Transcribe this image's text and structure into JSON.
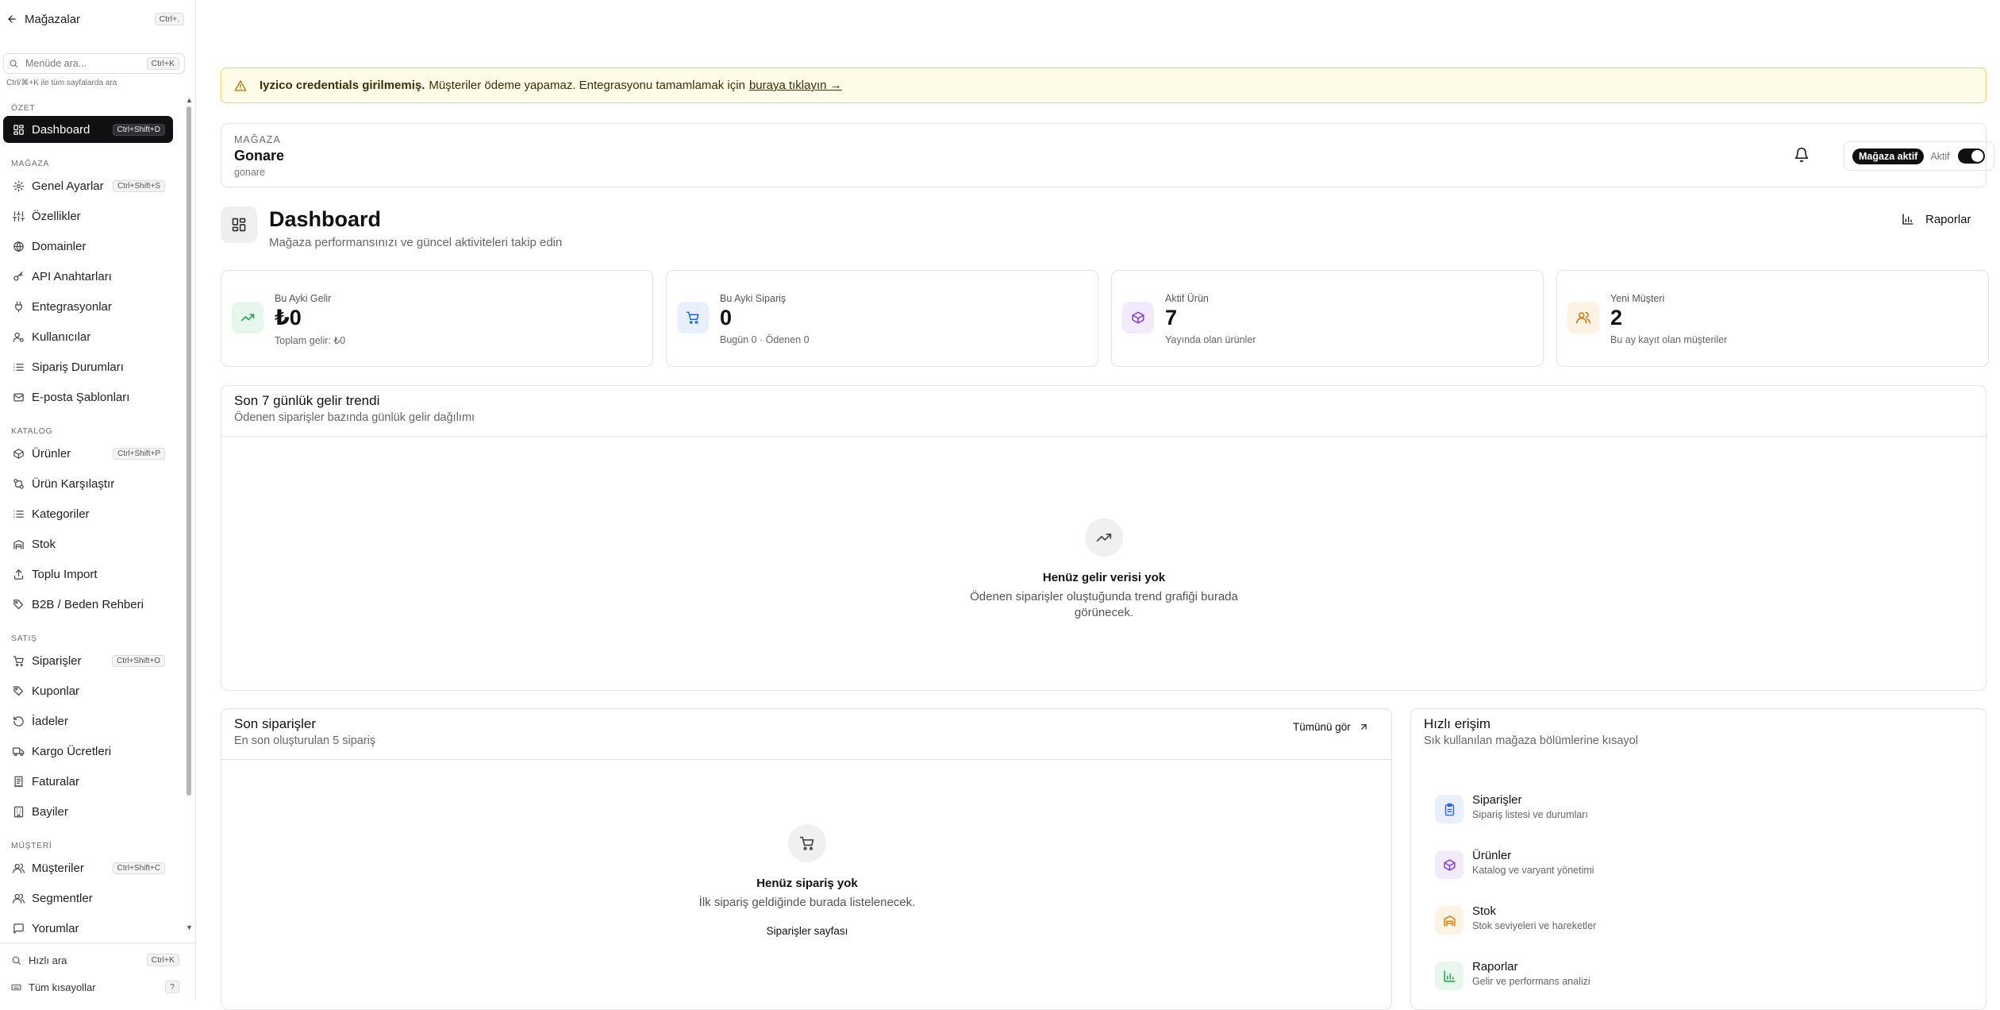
{
  "sidebar": {
    "back_label": "Mağazalar",
    "back_shortcut": "Ctrl+.",
    "search_placeholder": "Menüde ara...",
    "search_shortcut": "Ctrl+K",
    "search_hint": "Ctrl/⌘+K ile tüm sayfalarda ara",
    "sections": {
      "ozet": "ÖZET",
      "magaza": "MAĞAZA",
      "katalog": "KATALOG",
      "satis": "SATIŞ",
      "musteri": "MÜŞTERİ"
    },
    "items": {
      "dashboard": {
        "label": "Dashboard",
        "shortcut": "Ctrl+Shift+D"
      },
      "genel": {
        "label": "Genel Ayarlar",
        "shortcut": "Ctrl+Shift+S"
      },
      "ozellikler": {
        "label": "Özellikler"
      },
      "domainler": {
        "label": "Domainler"
      },
      "api": {
        "label": "API Anahtarları"
      },
      "entegrasyonlar": {
        "label": "Entegrasyonlar"
      },
      "kullanicilar": {
        "label": "Kullanıcılar"
      },
      "siparis_durumlari": {
        "label": "Sipariş Durumları"
      },
      "eposta": {
        "label": "E-posta Şablonları"
      },
      "urunler": {
        "label": "Ürünler",
        "shortcut": "Ctrl+Shift+P"
      },
      "karsilastir": {
        "label": "Ürün Karşılaştır"
      },
      "kategoriler": {
        "label": "Kategoriler"
      },
      "stok": {
        "label": "Stok"
      },
      "import": {
        "label": "Toplu Import"
      },
      "b2b": {
        "label": "B2B / Beden Rehberi"
      },
      "siparisler": {
        "label": "Siparişler",
        "shortcut": "Ctrl+Shift+O"
      },
      "kuponlar": {
        "label": "Kuponlar"
      },
      "iadeler": {
        "label": "İadeler"
      },
      "kargo": {
        "label": "Kargo Ücretleri"
      },
      "faturalar": {
        "label": "Faturalar"
      },
      "bayiler": {
        "label": "Bayiler"
      },
      "musteriler": {
        "label": "Müşteriler",
        "shortcut": "Ctrl+Shift+C"
      },
      "segmentler": {
        "label": "Segmentler"
      },
      "yorumlar": {
        "label": "Yorumlar"
      }
    },
    "footer": {
      "quick_search": "Hızlı ara",
      "quick_search_shortcut": "Ctrl+K",
      "all_shortcuts": "Tüm kısayollar",
      "all_shortcuts_key": "?"
    }
  },
  "alert": {
    "bold": "Iyzico credentials girilmemiş.",
    "text": "Müşteriler ödeme yapamaz. Entegrasyonu tamamlamak için",
    "link": "buraya tıklayın →"
  },
  "store": {
    "label": "MAĞAZA",
    "name": "Gonare",
    "slug": "gonare",
    "active_pill": "Mağaza aktif",
    "toggle_label": "Aktif",
    "toggle_on": true
  },
  "page": {
    "title": "Dashboard",
    "subtitle": "Mağaza performansınızı ve güncel aktiviteleri takip edin",
    "reports_button": "Raporlar"
  },
  "stats": [
    {
      "label": "Bu Ayki Gelir",
      "value": "₺0",
      "sub": "Toplam gelir: ₺0",
      "icon": "trending-up-icon",
      "color": "#16a34a",
      "bg": "#e8f7ee"
    },
    {
      "label": "Bu Ayki Sipariş",
      "value": "0",
      "sub": "Bugün 0 · Ödenen 0",
      "icon": "shopping-cart-icon",
      "color": "#2563eb",
      "bg": "#e8f0fd"
    },
    {
      "label": "Aktif Ürün",
      "value": "7",
      "sub": "Yayında olan ürünler",
      "icon": "package-icon",
      "color": "#7c3aed",
      "bg": "#f1ebfd"
    },
    {
      "label": "Yeni Müşteri",
      "value": "2",
      "sub": "Bu ay kayıt olan müşteriler",
      "icon": "users-icon",
      "color": "#d97706",
      "bg": "#fdf3e4"
    }
  ],
  "trend": {
    "title": "Son 7 günlük gelir trendi",
    "subtitle": "Ödenen siparişler bazında günlük gelir dağılımı",
    "empty_title": "Henüz gelir verisi yok",
    "empty_desc": "Ödenen siparişler oluştuğunda trend grafiği burada görünecek."
  },
  "orders": {
    "title": "Son siparişler",
    "subtitle": "En son oluşturulan 5 sipariş",
    "see_all": "Tümünü gör",
    "empty_title": "Henüz sipariş yok",
    "empty_desc": "İlk sipariş geldiğinde burada listelenecek.",
    "empty_link": "Siparişler sayfası"
  },
  "quick": {
    "title": "Hızlı erişim",
    "subtitle": "Sık kullanılan mağaza bölümlerine kısayol",
    "items": [
      {
        "title": "Siparişler",
        "desc": "Sipariş listesi ve durumları",
        "icon": "clipboard-icon",
        "color": "#2563eb",
        "bg": "#e8f0fd"
      },
      {
        "title": "Ürünler",
        "desc": "Katalog ve varyant yönetimi",
        "icon": "package-icon",
        "color": "#7c3aed",
        "bg": "#f1ebfd"
      },
      {
        "title": "Stok",
        "desc": "Stok seviyeleri ve hareketler",
        "icon": "warehouse-icon",
        "color": "#d97706",
        "bg": "#fdf3e4"
      },
      {
        "title": "Raporlar",
        "desc": "Gelir ve performans analizi",
        "icon": "bar-chart-icon",
        "color": "#16a34a",
        "bg": "#e8f7ee"
      }
    ]
  }
}
